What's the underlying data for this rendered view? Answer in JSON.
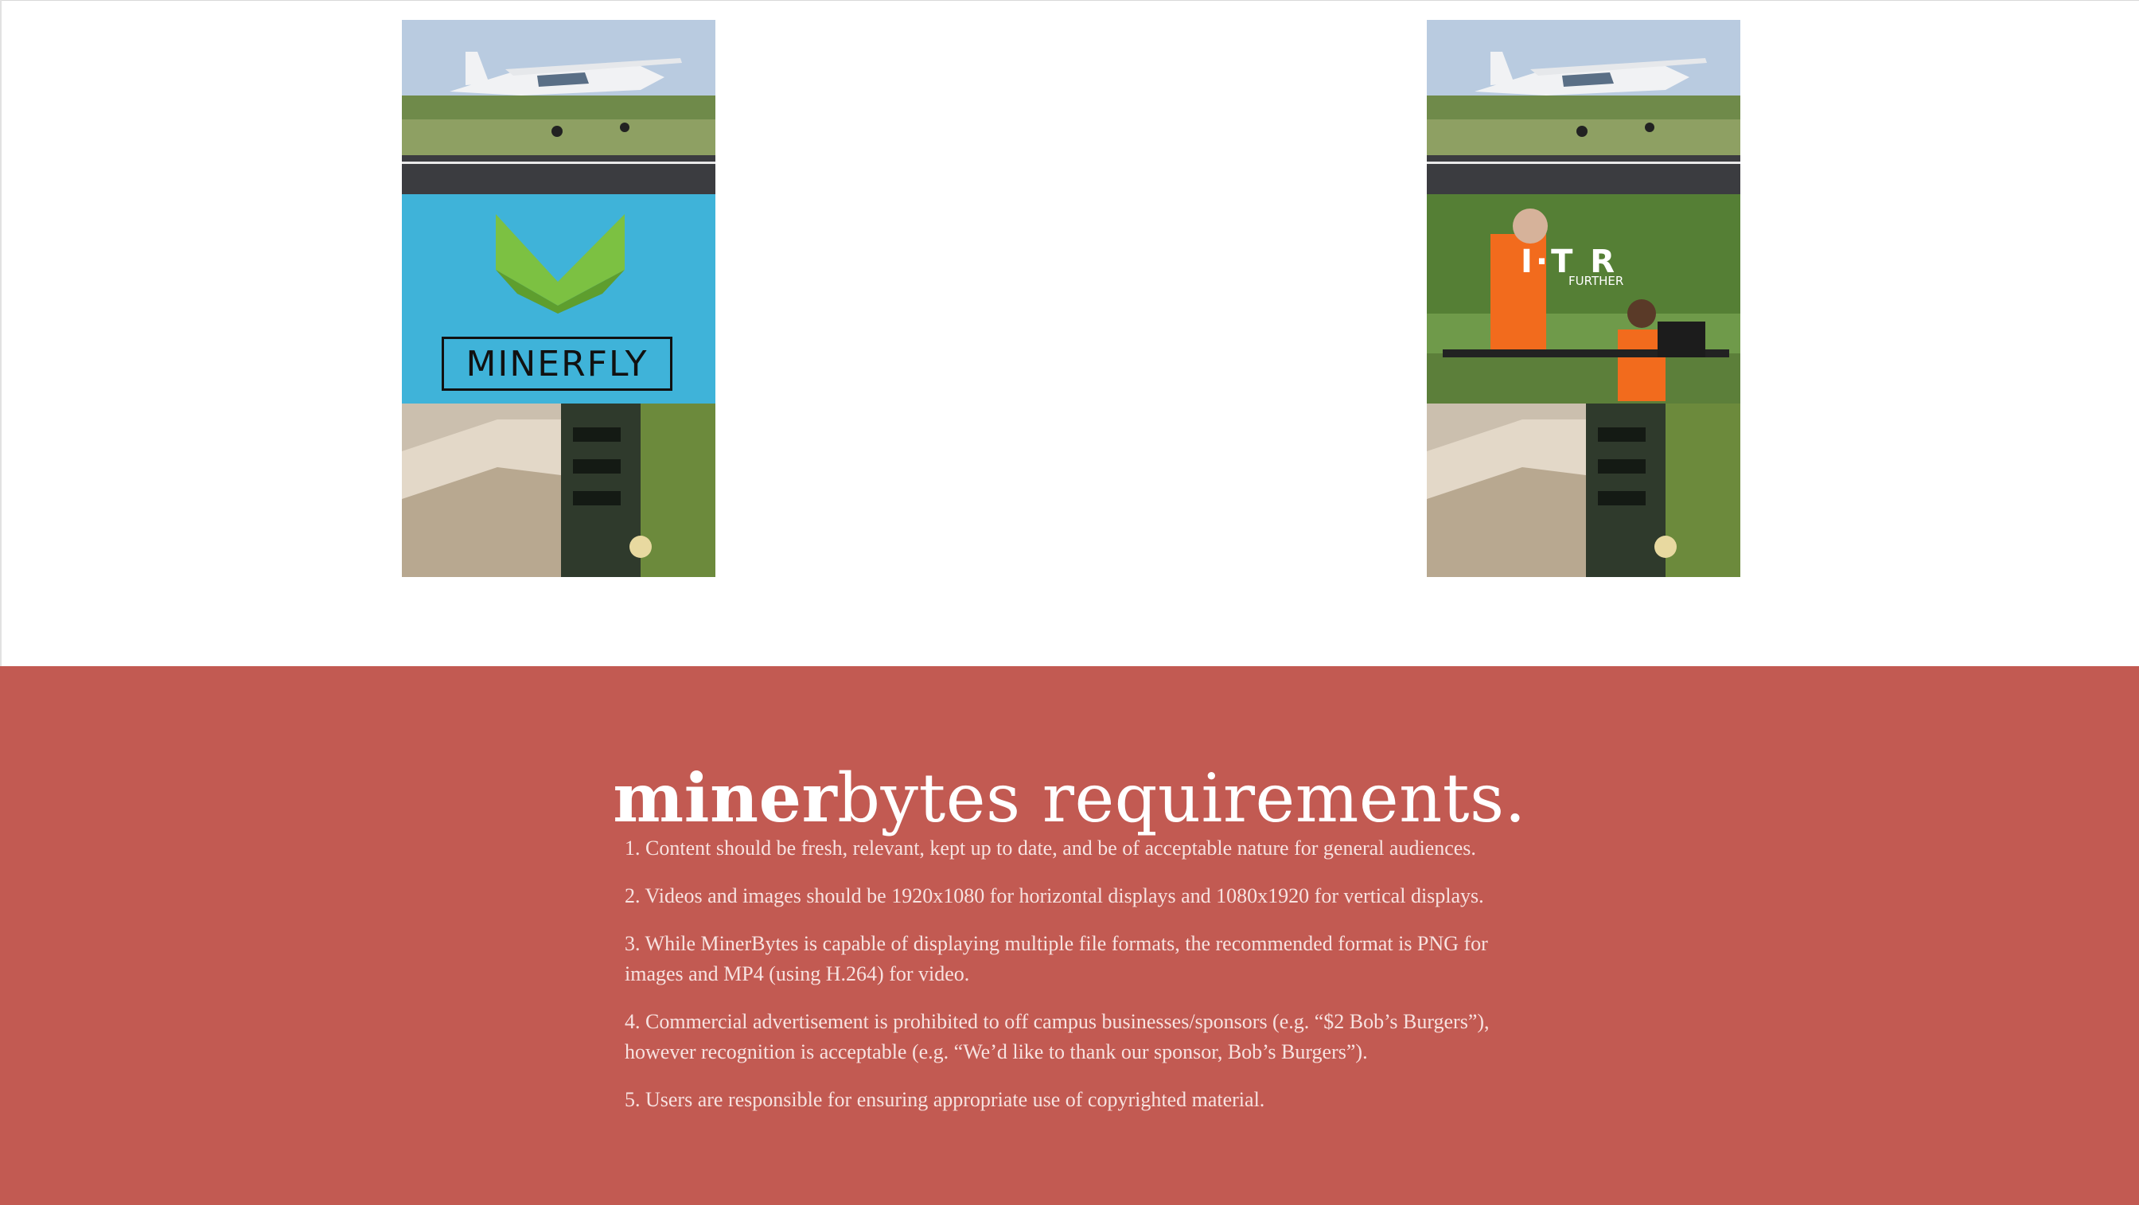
{
  "previews": {
    "left": {
      "minerfly_logo_text": "MINERFLY"
    },
    "right": {
      "drone_logo_text": "I·T R",
      "drone_tagline": "FURTHER"
    }
  },
  "requirements": {
    "title_strong": "miner",
    "title_rest": "bytes requirements.",
    "items": [
      "1. Content should be fresh, relevant, kept up to date, and be of acceptable nature for general audiences.",
      "2. Videos and images should be 1920x1080 for horizontal displays and 1080x1920 for vertical displays.",
      "3. While MinerBytes is capable of displaying multiple file formats, the recommended format is PNG for images and MP4 (using H.264) for video.",
      "4. Commercial advertisement is prohibited to off campus businesses/sponsors (e.g. “$2 Bob’s Burgers”), however recognition is acceptable (e.g. “We’d like to thank our sponsor, Bob’s Burgers”).",
      "5. Users are responsible for ensuring appropriate use of copyrighted material."
    ]
  },
  "colors": {
    "requirements_bg": "#c25a52",
    "minerfly_bg": "#3fb3d9",
    "minerfly_green": "#7cc142"
  }
}
